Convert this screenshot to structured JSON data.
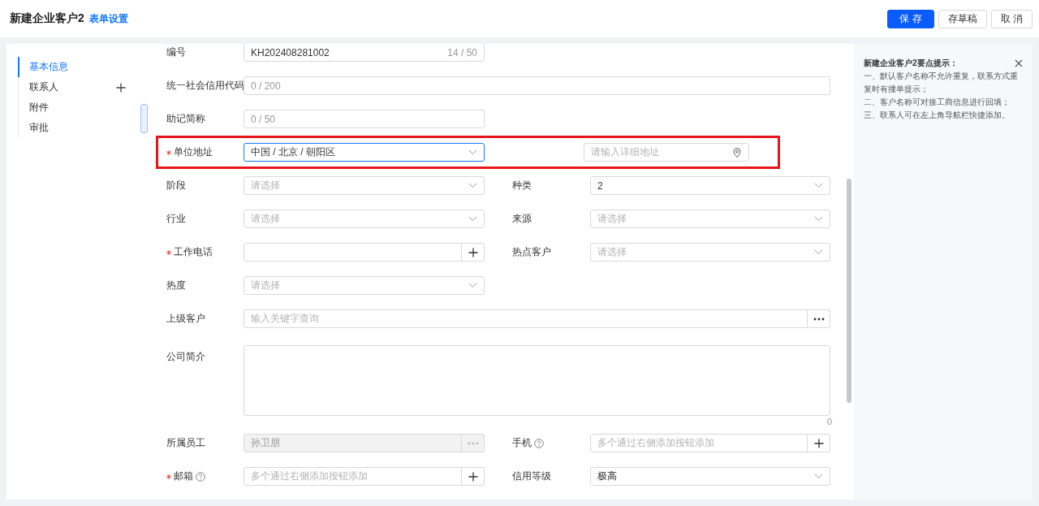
{
  "header": {
    "title": "新建企业客户2",
    "link": "表单设置",
    "buttons": [
      {
        "label": "保 存",
        "kind": "primary"
      },
      {
        "label": "存草稿",
        "kind": "default"
      },
      {
        "label": "取 消",
        "kind": "default"
      }
    ]
  },
  "nav": {
    "items": [
      {
        "label": "基本信息",
        "selected": true
      },
      {
        "label": "联系人",
        "selected": false,
        "addable": true
      },
      {
        "label": "附件",
        "selected": false
      },
      {
        "label": "审批",
        "selected": false
      }
    ]
  },
  "form": {
    "rows": [
      {
        "fields": [
          {
            "label": "编号",
            "kind": "text",
            "value": "KH202408281002",
            "counter": "14 / 50"
          }
        ]
      },
      {
        "fields": [
          {
            "label": "统一社会信用代码",
            "kind": "text",
            "wide": true,
            "counter": "0 / 200"
          }
        ]
      },
      {
        "fields": [
          {
            "label": "助记简称",
            "kind": "text",
            "counter": "0 / 50"
          }
        ]
      },
      {
        "highlighted": true,
        "fields": [
          {
            "label": "单位地址",
            "kind": "address",
            "required": true,
            "focused": true,
            "value": "中国 / 北京 / 朝阳区",
            "detail_placeholder": "请输入详细地址"
          }
        ]
      },
      {
        "fields": [
          {
            "label": "阶段",
            "kind": "select",
            "placeholder": "请选择"
          },
          {
            "label": "种类",
            "kind": "select",
            "value": "2"
          }
        ]
      },
      {
        "fields": [
          {
            "label": "行业",
            "kind": "select",
            "placeholder": "请选择"
          },
          {
            "label": "来源",
            "kind": "select",
            "placeholder": "请选择"
          }
        ]
      },
      {
        "fields": [
          {
            "label": "工作电话",
            "kind": "add",
            "required": true
          },
          {
            "label": "热点客户",
            "kind": "select",
            "placeholder": "请选择"
          }
        ]
      },
      {
        "fields": [
          {
            "label": "热度",
            "kind": "select",
            "placeholder": "请选择"
          }
        ]
      },
      {
        "fields": [
          {
            "label": "上级客户",
            "kind": "lookup",
            "wide": true,
            "placeholder": "输入关键字查询"
          }
        ]
      },
      {
        "fields": [
          {
            "label": "公司简介",
            "kind": "textarea",
            "wide": true,
            "counter": "0"
          }
        ]
      },
      {
        "fields": [
          {
            "label": "所属员工",
            "kind": "lookup",
            "disabled": true,
            "value": "孙卫朋"
          },
          {
            "label": "手机",
            "kind": "add",
            "help": true,
            "placeholder": "多个通过右侧添加按钮添加"
          }
        ]
      },
      {
        "fields": [
          {
            "label": "邮箱",
            "kind": "add",
            "required": true,
            "help": true,
            "placeholder": "多个通过右侧添加按钮添加"
          },
          {
            "label": "信用等级",
            "kind": "select",
            "value": "极高"
          }
        ]
      }
    ]
  },
  "tips": {
    "title": "新建企业客户2要点提示：",
    "lines": [
      "一、默认客户名称不允许重复，联系方式重复时有撞单提示；",
      "二、客户名称可对接工商信息进行回填；",
      "三、联系人可在左上角导航栏快捷添加。"
    ]
  }
}
